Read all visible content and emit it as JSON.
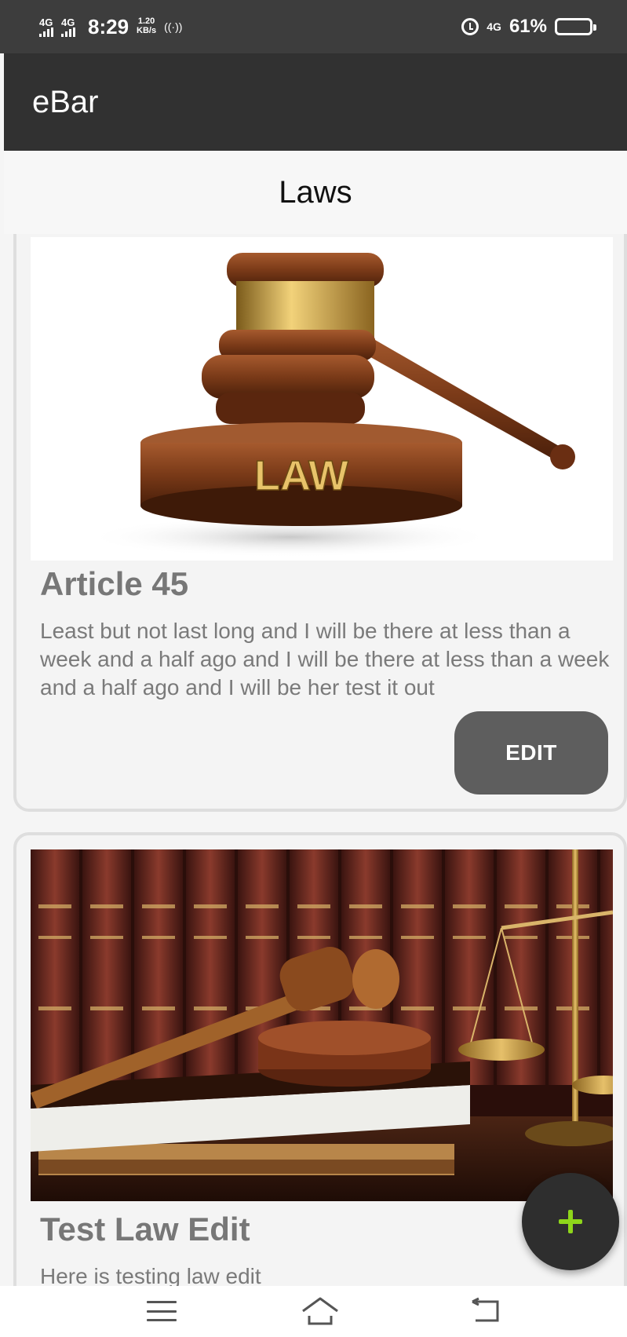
{
  "status_bar": {
    "sim1_network": "4G",
    "sim2_network": "4G",
    "time": "8:29",
    "data_speed_value": "1.20",
    "data_speed_unit": "KB/s",
    "hotspot_icon": "((·))",
    "mobile_data_label": "4G",
    "battery_percent": "61%",
    "battery_level": 0.61,
    "icons": [
      "signal-icon",
      "hotspot-icon",
      "alarm-icon",
      "battery-icon"
    ]
  },
  "app_bar": {
    "title": "eBar"
  },
  "page": {
    "title": "Laws"
  },
  "laws": [
    {
      "title": "Article 45",
      "description": "Least but not last long and I will be there at less than a week and a half ago and I will be there at less than a week and a half ago and I will be her test it out",
      "edit_label": "EDIT",
      "image_text": "LAW"
    },
    {
      "title": "Test Law Edit",
      "description": "Here is testing law edit"
    }
  ],
  "fab": {
    "icon": "plus-icon",
    "color": "#8ed61a"
  },
  "nav_bar": {
    "icons": [
      "menu-icon",
      "home-icon",
      "back-icon"
    ]
  },
  "colors": {
    "status_bar": "#3d3d3d",
    "app_bar": "#313131",
    "card_border": "#dedede",
    "edit_button": "#5e5e5e",
    "fab": "#2e2e2e",
    "fab_plus": "#8ed61a"
  }
}
